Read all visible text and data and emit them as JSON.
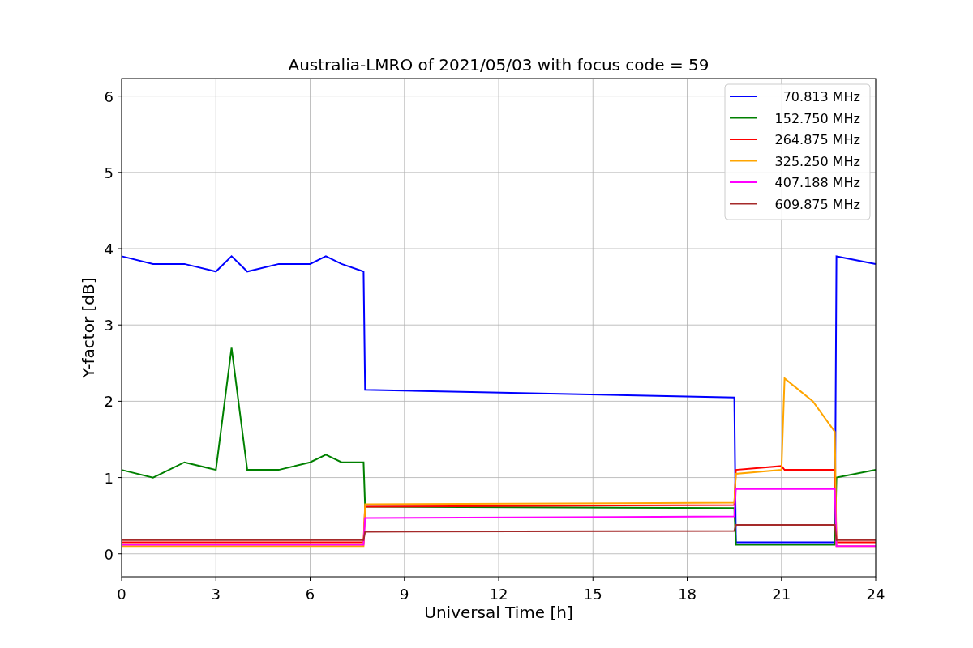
{
  "figure": {
    "chart_data": {
      "type": "line",
      "title": "Australia-LMRO of 2021/05/03 with focus code = 59",
      "xlabel": "Universal Time [h]",
      "ylabel": "Y-factor [dB]",
      "x": [
        0,
        1,
        2,
        3,
        3.5,
        4,
        5,
        6,
        6.5,
        7,
        7.7,
        7.75,
        19.5,
        19.55,
        21,
        21.1,
        22,
        22.7,
        22.75,
        24
      ],
      "series": [
        {
          "name": "70.813 MHz",
          "color": "#0000ff",
          "values": [
            3.9,
            3.8,
            3.8,
            3.7,
            3.9,
            3.7,
            3.8,
            3.8,
            3.9,
            3.8,
            3.7,
            2.15,
            2.05,
            0.15,
            0.15,
            0.15,
            0.15,
            0.15,
            3.9,
            3.8
          ]
        },
        {
          "name": "152.750 MHz",
          "color": "#008000",
          "values": [
            1.1,
            1.0,
            1.2,
            1.1,
            2.7,
            1.1,
            1.1,
            1.2,
            1.3,
            1.2,
            1.2,
            0.62,
            0.6,
            0.12,
            0.12,
            0.12,
            0.12,
            0.12,
            1.0,
            1.1
          ]
        },
        {
          "name": "264.875 MHz",
          "color": "#ff0000",
          "values": [
            0.15,
            0.15,
            0.15,
            0.15,
            0.15,
            0.15,
            0.15,
            0.15,
            0.15,
            0.15,
            0.15,
            0.62,
            0.64,
            1.1,
            1.15,
            1.1,
            1.1,
            1.1,
            0.15,
            0.15
          ]
        },
        {
          "name": "325.250 MHz",
          "color": "#ffa500",
          "values": [
            0.1,
            0.1,
            0.1,
            0.1,
            0.1,
            0.1,
            0.1,
            0.1,
            0.1,
            0.1,
            0.1,
            0.65,
            0.67,
            1.05,
            1.1,
            2.3,
            2.0,
            1.6,
            0.1,
            0.1
          ]
        },
        {
          "name": "407.188 MHz",
          "color": "#ff00ff",
          "values": [
            0.12,
            0.12,
            0.12,
            0.12,
            0.12,
            0.12,
            0.12,
            0.12,
            0.12,
            0.12,
            0.12,
            0.47,
            0.49,
            0.85,
            0.85,
            0.85,
            0.85,
            0.85,
            0.1,
            0.1
          ]
        },
        {
          "name": "609.875 MHz",
          "color": "#a52a2a",
          "values": [
            0.18,
            0.18,
            0.18,
            0.18,
            0.18,
            0.18,
            0.18,
            0.18,
            0.18,
            0.18,
            0.18,
            0.29,
            0.3,
            0.38,
            0.38,
            0.38,
            0.38,
            0.38,
            0.18,
            0.18
          ]
        }
      ],
      "grid": true,
      "legend": "upper right",
      "xlim": [
        0,
        24
      ],
      "ylim": [
        -0.3,
        6.23
      ],
      "xticks": [
        0,
        3,
        6,
        9,
        12,
        15,
        18,
        21,
        24
      ],
      "yticks": [
        0,
        1,
        2,
        3,
        4,
        5,
        6
      ]
    }
  }
}
